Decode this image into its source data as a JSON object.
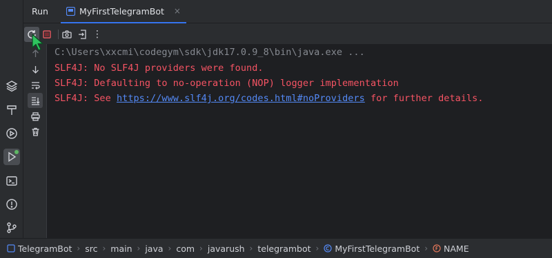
{
  "tool_window": {
    "title": "Run",
    "tab_label": "MyFirstTelegramBot",
    "tab_close": "×"
  },
  "left_toolbar": {
    "icons": [
      "layers-icon",
      "hammer-icon",
      "services-icon",
      "run-icon",
      "terminal-icon",
      "problems-icon",
      "git-icon"
    ],
    "run_badge_color": "#5fb865"
  },
  "toolbar": {
    "icons": [
      "rerun-icon",
      "stop-icon",
      "camera-icon",
      "exit-icon",
      "more-icon"
    ],
    "more_label": "⋮"
  },
  "console_actions": {
    "icons": [
      "up-arrow-icon",
      "down-arrow-icon",
      "soft-wrap-icon",
      "scroll-to-end-icon",
      "print-icon",
      "trash-icon"
    ]
  },
  "console": {
    "command": "C:\\Users\\xxcmi\\codegym\\sdk\\jdk17.0.9_8\\bin\\java.exe ...",
    "line1": "SLF4J: No SLF4J providers were found.",
    "line2": "SLF4J: Defaulting to no-operation (NOP) logger implementation",
    "line3_prefix": "SLF4J: See ",
    "line3_link": "https://www.slf4j.org/codes.html#noProviders",
    "line3_suffix": " for further details."
  },
  "breadcrumbs": {
    "items": [
      "TelegramBot",
      "src",
      "main",
      "java",
      "com",
      "javarush",
      "telegrambot",
      "MyFirstTelegramBot",
      "NAME"
    ],
    "separator": "›"
  },
  "colors": {
    "accent": "#3574f0",
    "error": "#f75464",
    "link": "#548af7",
    "console_bg": "#1e1f22",
    "panel_bg": "#2b2d30",
    "cursor": "#2fc45f"
  }
}
